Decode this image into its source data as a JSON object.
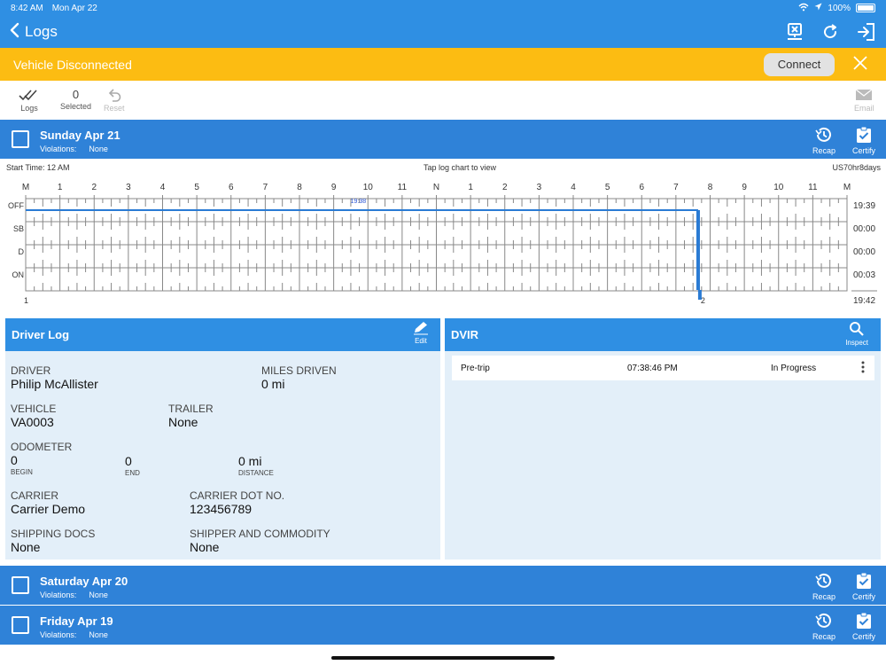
{
  "statusbar": {
    "time": "8:42 AM",
    "date": "Mon Apr 22",
    "battery": "100%"
  },
  "nav": {
    "back_label": "Logs"
  },
  "banner": {
    "message": "Vehicle Disconnected",
    "connect_label": "Connect"
  },
  "toolbar": {
    "logs_label": "Logs",
    "selected_count": "0",
    "selected_label": "Selected",
    "reset_label": "Reset",
    "email_label": "Email"
  },
  "days": [
    {
      "title": "Sunday Apr 21",
      "violations_label": "Violations:",
      "violations": "None",
      "recap_label": "Recap",
      "certify_label": "Certify"
    },
    {
      "title": "Saturday Apr 20",
      "violations_label": "Violations:",
      "violations": "None",
      "recap_label": "Recap",
      "certify_label": "Certify"
    },
    {
      "title": "Friday Apr 19",
      "violations_label": "Violations:",
      "violations": "None",
      "recap_label": "Recap",
      "certify_label": "Certify"
    }
  ],
  "chart_info": {
    "start_time": "Start Time: 12 AM",
    "hint": "Tap log chart to view",
    "rule": "US70hr8days"
  },
  "chart_data": {
    "type": "line",
    "hour_labels": [
      "M",
      "1",
      "2",
      "3",
      "4",
      "5",
      "6",
      "7",
      "8",
      "9",
      "10",
      "11",
      "N",
      "1",
      "2",
      "3",
      "4",
      "5",
      "6",
      "7",
      "8",
      "9",
      "10",
      "11",
      "M"
    ],
    "status_labels": [
      "OFF",
      "SB",
      "D",
      "ON"
    ],
    "totals": [
      "19:39",
      "00:00",
      "00:00",
      "00:03"
    ],
    "grand_total": "19:42",
    "segments": [
      {
        "status": "OFF",
        "start_hour": 0,
        "end_hour": 19.65
      },
      {
        "status": "ON",
        "start_hour": 19.65,
        "end_hour": 19.7
      }
    ],
    "off_marker_label": "19:38",
    "off_marker_hour": 9.75,
    "bottom_left_label": "1",
    "bottom_marker_label": "2",
    "bottom_marker_hour": 19.7,
    "colors": {
      "line": "#2a7bd4",
      "grid": "#888888"
    }
  },
  "driver_log": {
    "title": "Driver Log",
    "edit_label": "Edit",
    "driver_label": "DRIVER",
    "driver": "Philip McAllister",
    "miles_label": "MILES DRIVEN",
    "miles": "0 mi",
    "vehicle_label": "VEHICLE",
    "vehicle": "VA0003",
    "trailer_label": "TRAILER",
    "trailer": "None",
    "odometer_label": "ODOMETER",
    "odo_begin": "0",
    "odo_begin_label": "BEGIN",
    "odo_end": "0",
    "odo_end_label": "END",
    "odo_distance": "0 mi",
    "odo_distance_label": "DISTANCE",
    "carrier_label": "CARRIER",
    "carrier": "Carrier Demo",
    "dot_label": "CARRIER DOT NO.",
    "dot": "123456789",
    "shipping_docs_label": "SHIPPING DOCS",
    "shipping_docs": "None",
    "shipper_label": "SHIPPER AND COMMODITY",
    "shipper": "None"
  },
  "dvir": {
    "title": "DVIR",
    "inspect_label": "Inspect",
    "rows": [
      {
        "type": "Pre-trip",
        "time": "07:38:46 PM",
        "status": "In Progress"
      }
    ]
  },
  "colors": {
    "primary": "#2f8fe3",
    "day_row": "#2f82d8",
    "warning": "#fcbc12",
    "panel_bg": "#e3eff9"
  }
}
